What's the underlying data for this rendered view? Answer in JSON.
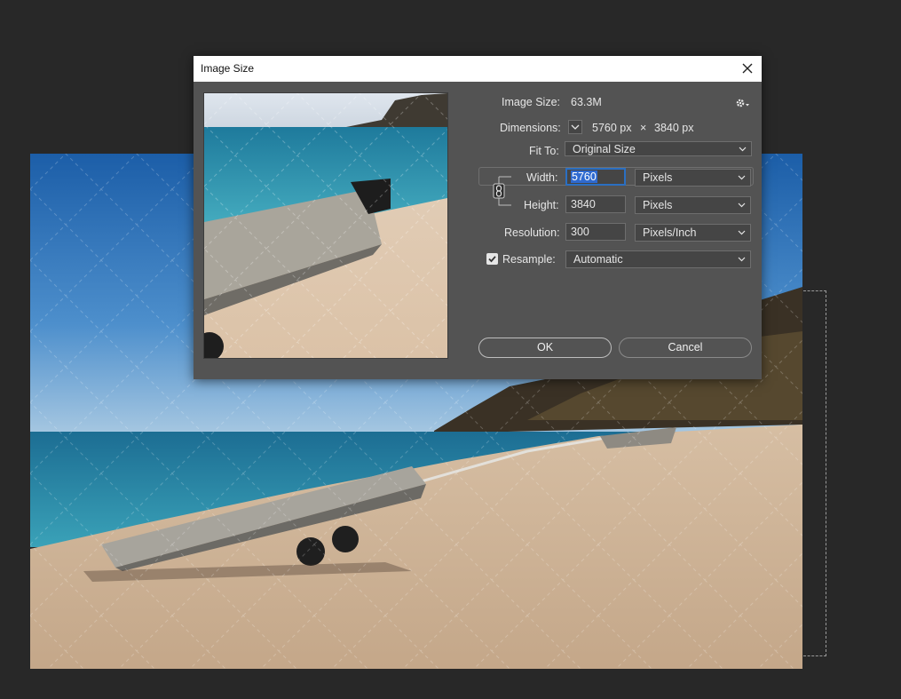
{
  "dialog": {
    "title": "Image Size",
    "image_size_label": "Image Size:",
    "image_size_value": "63.3M",
    "dimensions_label": "Dimensions:",
    "dimensions_width": "5760 px",
    "dimensions_times": "×",
    "dimensions_height": "3840 px",
    "fit_to_label": "Fit To:",
    "fit_to_value": "Original Size",
    "width_label": "Width:",
    "width_value": "5760",
    "width_unit": "Pixels",
    "height_label": "Height:",
    "height_value": "3840",
    "height_unit": "Pixels",
    "resolution_label": "Resolution:",
    "resolution_value": "300",
    "resolution_unit": "Pixels/Inch",
    "resample_label": "Resample:",
    "resample_checked": true,
    "resample_value": "Automatic",
    "ok_label": "OK",
    "cancel_label": "Cancel"
  },
  "icons": {
    "close": "close-icon",
    "settings": "gear-icon",
    "dimensions_toggle": "chevron-down-icon",
    "constrain": "chain-link-icon",
    "checkbox": "checkmark-icon"
  },
  "colors": {
    "workspace_bg": "#282828",
    "dialog_bg": "#535353",
    "field_bg": "#454545",
    "selection": "#2f6ad0",
    "focus_ring": "#2b6fc2"
  }
}
